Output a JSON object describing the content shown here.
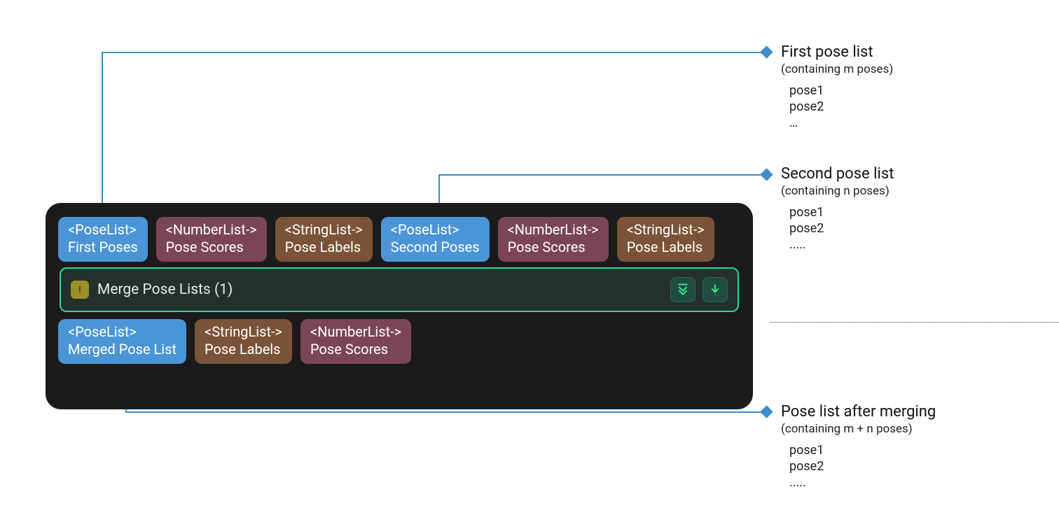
{
  "node": {
    "title": "Merge Pose Lists (1)",
    "inputs": [
      {
        "type": "<PoseList>",
        "label": "First Poses",
        "kind": "pose"
      },
      {
        "type": "<NumberList->",
        "label": "Pose Scores",
        "kind": "number"
      },
      {
        "type": "<StringList->",
        "label": "Pose Labels",
        "kind": "string"
      },
      {
        "type": "<PoseList>",
        "label": "Second Poses",
        "kind": "pose"
      },
      {
        "type": "<NumberList->",
        "label": "Pose Scores",
        "kind": "number"
      },
      {
        "type": "<StringList->",
        "label": "Pose Labels",
        "kind": "string"
      }
    ],
    "outputs": [
      {
        "type": "<PoseList>",
        "label": "Merged Pose List",
        "kind": "pose"
      },
      {
        "type": "<StringList->",
        "label": "Pose Labels",
        "kind": "string"
      },
      {
        "type": "<NumberList->",
        "label": "Pose Scores",
        "kind": "number"
      }
    ]
  },
  "annotations": {
    "first": {
      "title": "First pose list",
      "subtitle": "(containing m poses)",
      "items": [
        "pose1",
        "pose2",
        "…"
      ]
    },
    "second": {
      "title": "Second pose list",
      "subtitle": "(containing n poses)",
      "items": [
        "pose1",
        "pose2",
        "....."
      ]
    },
    "merged": {
      "title": "Pose list after merging",
      "subtitle": "(containing m + n poses)",
      "items": [
        "pose1",
        "pose2",
        "....."
      ]
    }
  }
}
